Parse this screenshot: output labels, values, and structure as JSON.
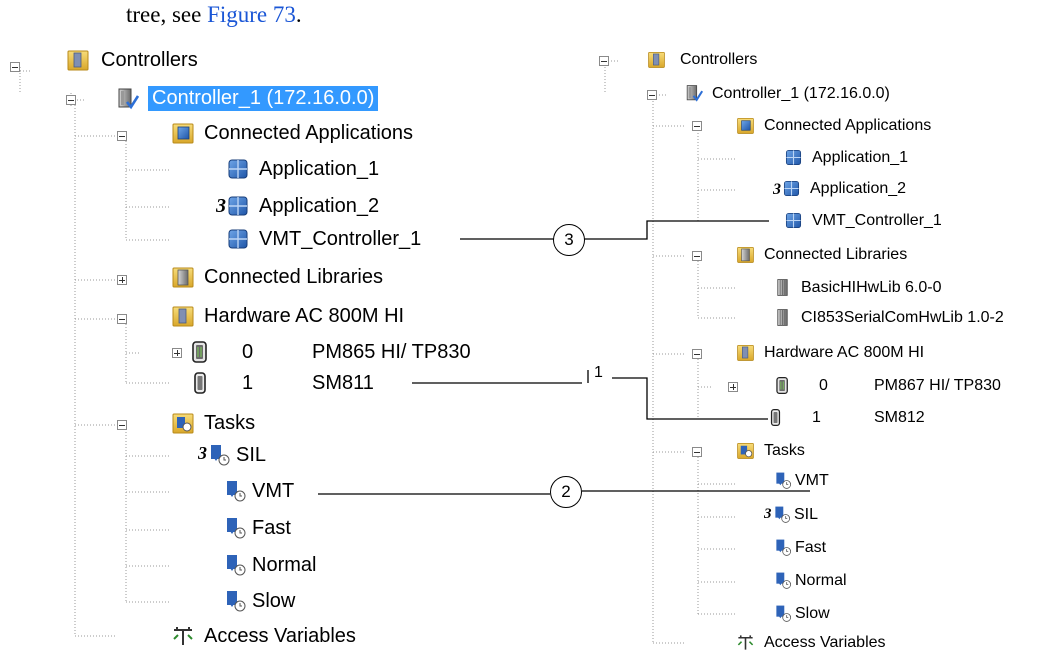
{
  "caption": {
    "text": "tree, see ",
    "link": "Figure 73",
    "end": "."
  },
  "left": {
    "controllers": "Controllers",
    "controller": "Controller_1 (172.16.0.0)",
    "connected_apps": "Connected Applications",
    "app1": "Application_1",
    "app2": "Application_2",
    "vmt": "VMT_Controller_1",
    "connected_libs": "Connected Libraries",
    "hardware": "Hardware  AC 800M HI",
    "hw0_pos": "0",
    "hw0_name": "PM865 HI/ TP830",
    "hw1_pos": "1",
    "hw1_name": "SM811",
    "tasks": "Tasks",
    "task_sil": "SIL",
    "task_vmt": "VMT",
    "task_fast": "Fast",
    "task_normal": "Normal",
    "task_slow": "Slow",
    "access": "Access Variables"
  },
  "right": {
    "controllers": "Controllers",
    "controller": "Controller_1 (172.16.0.0)",
    "connected_apps": "Connected Applications",
    "app1": "Application_1",
    "app2": "Application_2",
    "vmt": "VMT_Controller_1",
    "connected_libs": "Connected Libraries",
    "lib1": "BasicHIHwLib 6.0-0",
    "lib2": "CI853SerialComHwLib 1.0-2",
    "hardware": "Hardware  AC 800M HI",
    "hw0_pos": "0",
    "hw0_name": "PM867 HI/ TP830",
    "hw1_pos": "1",
    "hw1_name": "SM812",
    "tasks": "Tasks",
    "task_vmt": "VMT",
    "task_sil": "SIL",
    "task_fast": "Fast",
    "task_normal": "Normal",
    "task_slow": "Slow",
    "access": "Access Variables"
  },
  "callouts": {
    "c1": "1",
    "c2": "2",
    "c3": "3"
  },
  "icon_badge_sil": "3",
  "colors": {
    "selection": "#3399ff",
    "link": "#1a56d6"
  }
}
